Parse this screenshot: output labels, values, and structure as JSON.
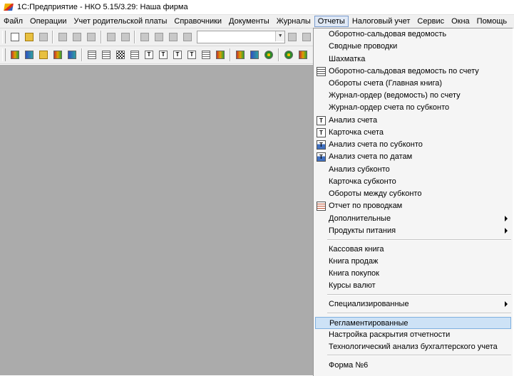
{
  "window": {
    "title": "1С:Предприятие - НКО 5.15/3.29: Наша фирма"
  },
  "menubar": {
    "items": [
      "Файл",
      "Операции",
      "Учет родительской платы",
      "Справочники",
      "Документы",
      "Журналы",
      "Отчеты",
      "Налоговый учет",
      "Сервис",
      "Окна",
      "Помощь"
    ],
    "active": "Отчеты"
  },
  "toolbar": {
    "search_value": ""
  },
  "reports_menu": {
    "items": [
      {
        "label": "Оборотно-сальдовая ведомость",
        "icon": "none"
      },
      {
        "label": "Сводные проводки",
        "icon": "none"
      },
      {
        "label": "Шахматка",
        "icon": "none"
      },
      {
        "label": "Оборотно-сальдовая ведомость по счету",
        "icon": "grid-report-icon"
      },
      {
        "label": "Обороты счета (Главная книга)",
        "icon": "none"
      },
      {
        "label": "Журнал-ордер (ведомость) по счету",
        "icon": "none"
      },
      {
        "label": "Журнал-ордер счета по субконто",
        "icon": "none"
      },
      {
        "label": "Анализ счета",
        "icon": "account-analysis-icon"
      },
      {
        "label": "Карточка счета",
        "icon": "account-card-icon"
      },
      {
        "label": "Анализ счета по субконто",
        "icon": "subconto-analysis-icon"
      },
      {
        "label": "Анализ счета по датам",
        "icon": "date-analysis-icon"
      },
      {
        "label": "Анализ субконто",
        "icon": "none"
      },
      {
        "label": "Карточка субконто",
        "icon": "none"
      },
      {
        "label": "Обороты между субконто",
        "icon": "none"
      },
      {
        "label": "Отчет по проводкам",
        "icon": "entries-report-icon"
      },
      {
        "label": "Дополнительные",
        "icon": "none",
        "submenu": true
      },
      {
        "label": "Продукты питания",
        "icon": "none",
        "submenu": true
      },
      {
        "label": "Кассовая книга",
        "icon": "none"
      },
      {
        "label": "Книга продаж",
        "icon": "none"
      },
      {
        "label": "Книга покупок",
        "icon": "none"
      },
      {
        "label": "Курсы валют",
        "icon": "none"
      },
      {
        "label": "Специализированные",
        "icon": "none",
        "submenu": true
      },
      {
        "label": "Регламентированные",
        "icon": "none",
        "highlighted": true
      },
      {
        "label": "Настройка раскрытия отчетности",
        "icon": "none"
      },
      {
        "label": "Технологический анализ бухгалтерского учета",
        "icon": "none"
      },
      {
        "label": "Форма №6",
        "icon": "none"
      }
    ],
    "icon_letters": {
      "account-analysis-icon": "T",
      "account-card-icon": "T",
      "subconto-analysis-icon": "T",
      "date-analysis-icon": "T"
    }
  },
  "colors": {
    "workspace": "#ababab",
    "menu_bg": "#f5f5f5",
    "highlight": "#cde2f6"
  }
}
